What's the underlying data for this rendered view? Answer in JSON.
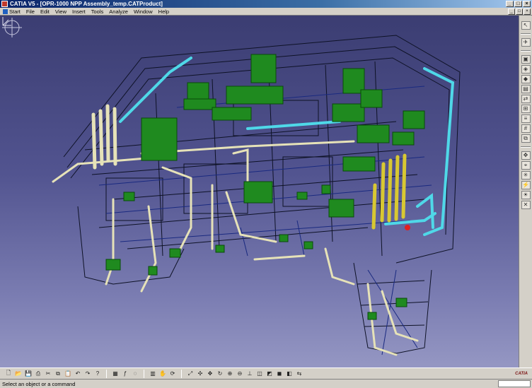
{
  "window": {
    "title": "CATIA V5 - [OPR-1000 NPP Assembly_temp.CATProduct]",
    "minimize": "_",
    "maximize": "□",
    "close": "×"
  },
  "menu": {
    "items": [
      "Start",
      "File",
      "Edit",
      "View",
      "Insert",
      "Tools",
      "Analyze",
      "Window",
      "Help"
    ]
  },
  "status": {
    "message": "Select an object or a command"
  },
  "colors": {
    "background_top": "#3b3d72",
    "background_bottom": "#9597c3",
    "equipment": "#1f8a1f",
    "pipe_beige": "#e6e2b8",
    "pipe_cyan": "#4fd8e8",
    "pipe_yellow": "#d8c832",
    "wire_dark": "#101428"
  },
  "right_toolbar_icons": [
    "select-icon",
    "fly-icon",
    "product-icon",
    "component-icon",
    "part-icon",
    "existing-component-icon",
    "replace-icon",
    "graph-tree-icon",
    "reorder-icon",
    "numbering-icon",
    "multi-instantiate-icon",
    "manipulate-icon",
    "snap-icon",
    "explode-icon",
    "clash-icon",
    "sectioning-icon",
    "measure-icon",
    "annotation-icon",
    "scene-icon",
    "light-icon",
    "delete-icon"
  ],
  "bottom_toolbar_icons": [
    "new-icon",
    "open-icon",
    "save-icon",
    "print-icon",
    "cut-icon",
    "copy-icon",
    "paste-icon",
    "undo-icon",
    "redo-icon",
    "whats-this-icon",
    "catalog-icon",
    "formula-icon",
    "fly-mode-icon",
    "pan-icon",
    "rotate-icon",
    "zoom-in-icon",
    "zoom-out-icon",
    "normal-view-icon",
    "iso-view-icon",
    "shading-icon",
    "hide-show-icon",
    "swap-space-icon"
  ]
}
